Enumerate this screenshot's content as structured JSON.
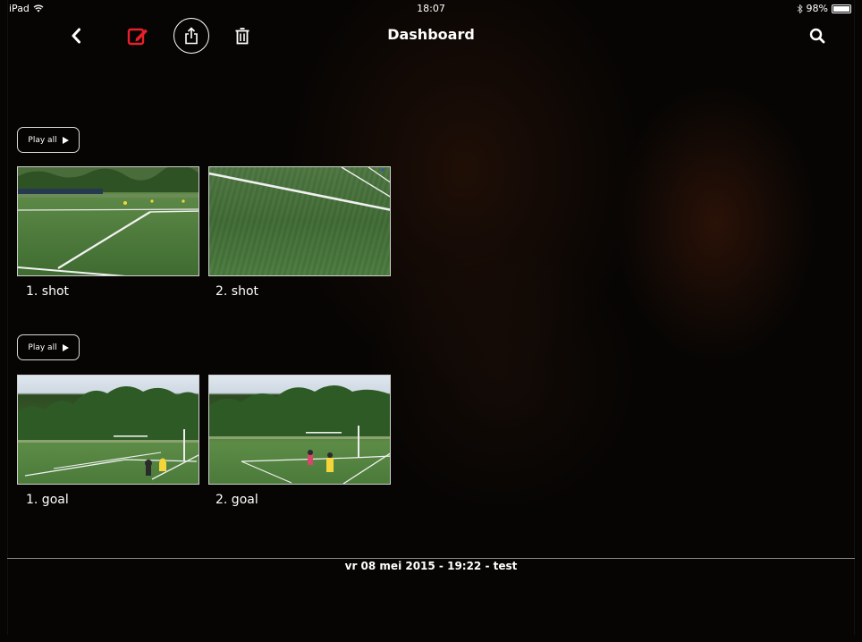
{
  "status_bar": {
    "device": "iPad",
    "time": "18:07",
    "battery": "98%"
  },
  "nav": {
    "title": "Dashboard",
    "icons": [
      "chevron-left-icon",
      "edit-icon",
      "share-icon",
      "trash-icon",
      "search-icon"
    ],
    "edit_icon_color": "#e8202a"
  },
  "sections": [
    {
      "play_all_label": "Play all",
      "clips": [
        {
          "label": "1. shot"
        },
        {
          "label": "2. shot"
        }
      ]
    },
    {
      "play_all_label": "Play all",
      "clips": [
        {
          "label": "1. goal"
        },
        {
          "label": "2. goal"
        }
      ]
    }
  ],
  "footer": {
    "session": "vr 08 mei 2015 - 19:22 - test"
  }
}
